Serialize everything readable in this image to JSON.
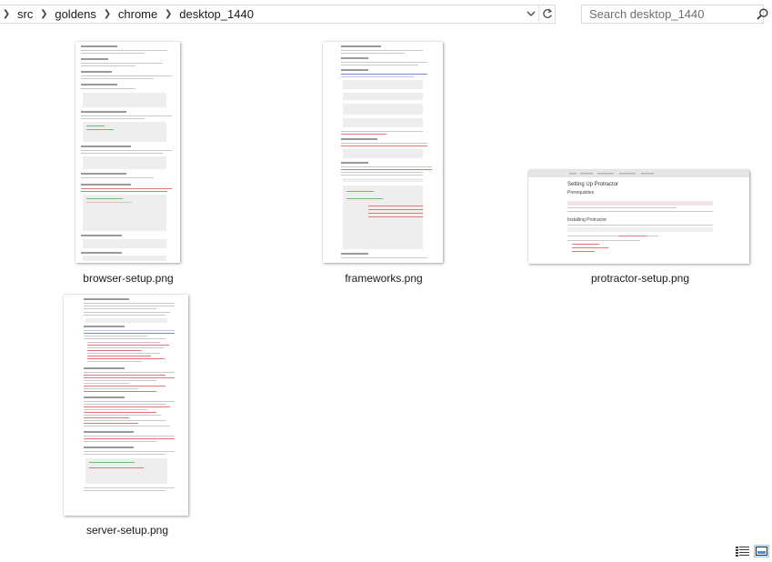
{
  "address_bar": {
    "breadcrumbs": [
      "src",
      "goldens",
      "chrome",
      "desktop_1440"
    ],
    "dropdown_icon": "chevron-down-icon",
    "refresh_icon": "refresh-icon"
  },
  "search": {
    "placeholder": "Search desktop_1440",
    "icon": "search-icon"
  },
  "files": [
    {
      "name": "browser-setup.png"
    },
    {
      "name": "frameworks.png"
    },
    {
      "name": "protractor-setup.png"
    },
    {
      "name": "server-setup.png"
    }
  ],
  "protractor_preview": {
    "title": "Setting Up Protractor",
    "h_prereq": "Prerequisites",
    "h_install": "Installing Protractor"
  },
  "view_buttons": [
    "details-view-icon",
    "large-icons-view-icon"
  ],
  "colors": {
    "border": "#d9d9d9",
    "accent_selected": "#0078d7"
  }
}
